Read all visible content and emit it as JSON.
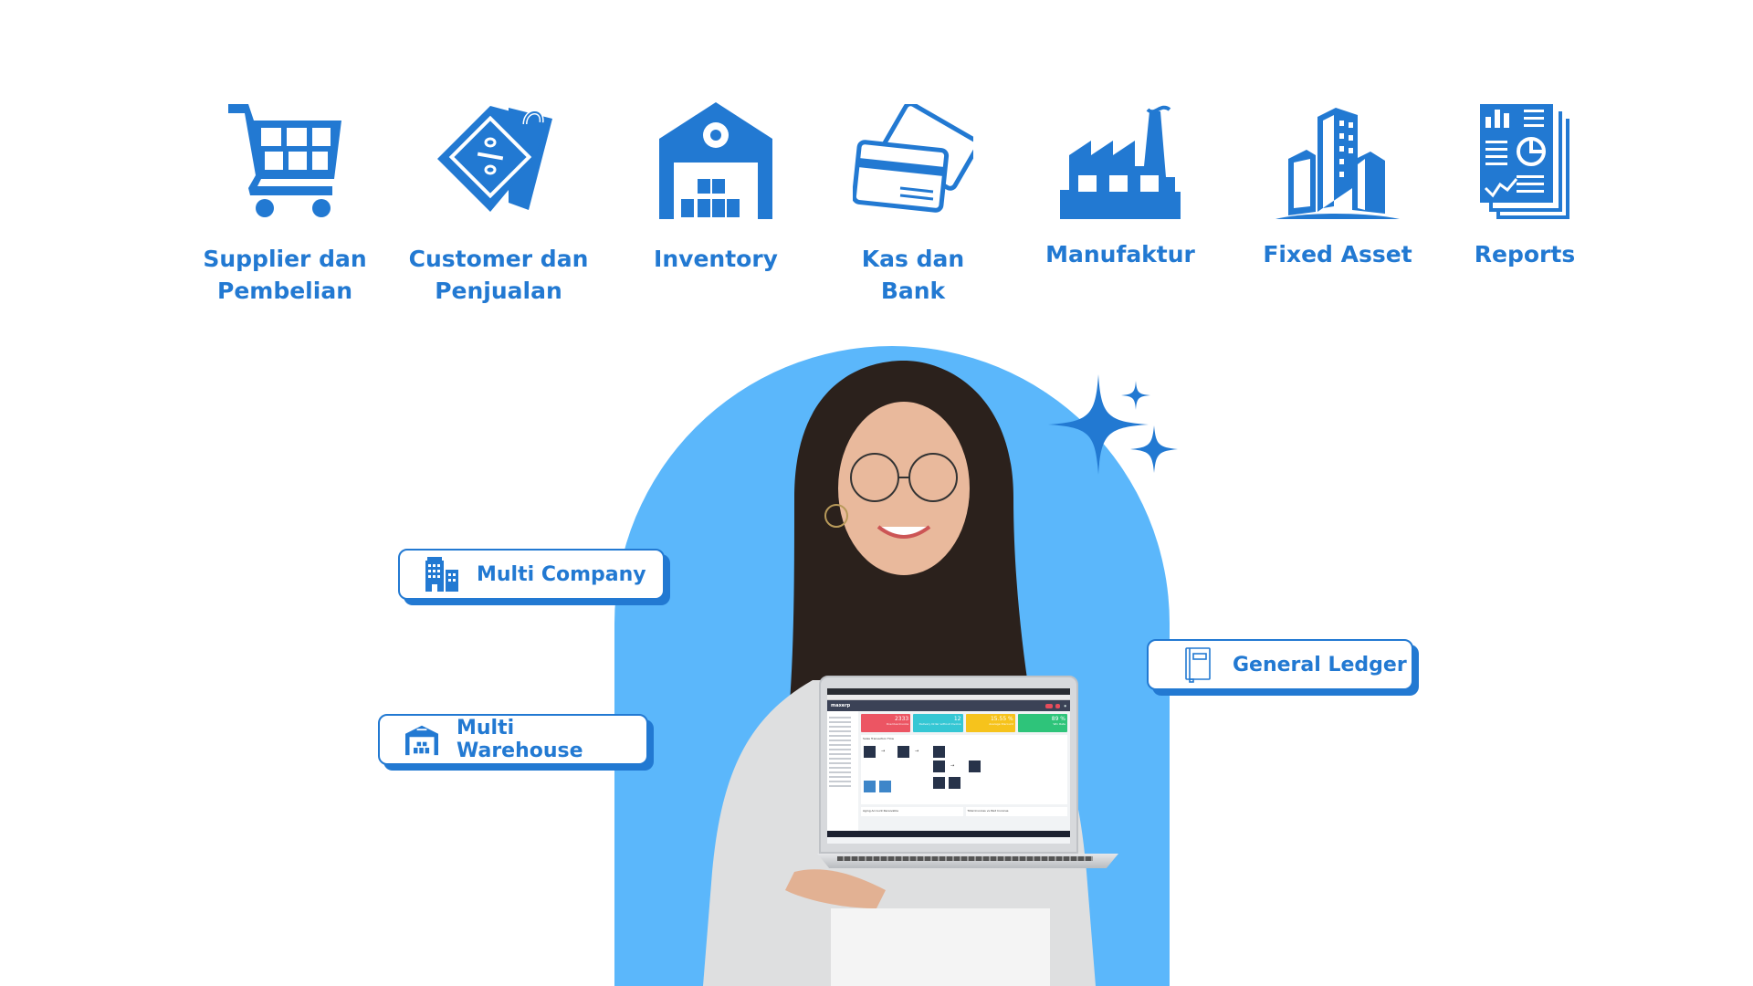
{
  "colors": {
    "primary": "#2279d2",
    "arch": "#5bb7fb",
    "background": "#ffffff"
  },
  "features": [
    {
      "icon": "shopping-cart-icon",
      "lines": [
        "Supplier dan",
        "Pembelian"
      ]
    },
    {
      "icon": "price-tag-icon",
      "lines": [
        "Customer dan",
        "Penjualan"
      ]
    },
    {
      "icon": "warehouse-icon",
      "lines": [
        "Inventory"
      ]
    },
    {
      "icon": "credit-cards-icon",
      "lines": [
        "Kas dan",
        "Bank"
      ]
    },
    {
      "icon": "factory-icon",
      "lines": [
        "Manufaktur"
      ]
    },
    {
      "icon": "buildings-icon",
      "lines": [
        "Fixed Asset"
      ]
    },
    {
      "icon": "report-document-icon",
      "lines": [
        "Reports"
      ]
    }
  ],
  "badges": {
    "multi_company": {
      "icon": "office-building-icon",
      "label": "Multi Company"
    },
    "multi_warehouse": {
      "icon": "warehouse-icon",
      "label": "Multi Warehouse"
    },
    "general_ledger": {
      "icon": "ledger-book-icon",
      "label": "General Ledger"
    }
  },
  "laptop_screen": {
    "logo": "maxerp",
    "cards": [
      {
        "value": "2333",
        "label": "Overdue Invoice",
        "color": "#ec5563"
      },
      {
        "value": "12",
        "label": "Delivery Order without Invoice",
        "color": "#35c7d4"
      },
      {
        "value": "15.55 %",
        "label": "Average Discount",
        "color": "#f6c31c"
      },
      {
        "value": "89 %",
        "label": "Win Rate",
        "color": "#2ec47a"
      }
    ],
    "flow_title": "Sales Transaction Flow",
    "panels": [
      "Aging Account Receivable",
      "Total Invoices vs Paid Invoices"
    ]
  }
}
